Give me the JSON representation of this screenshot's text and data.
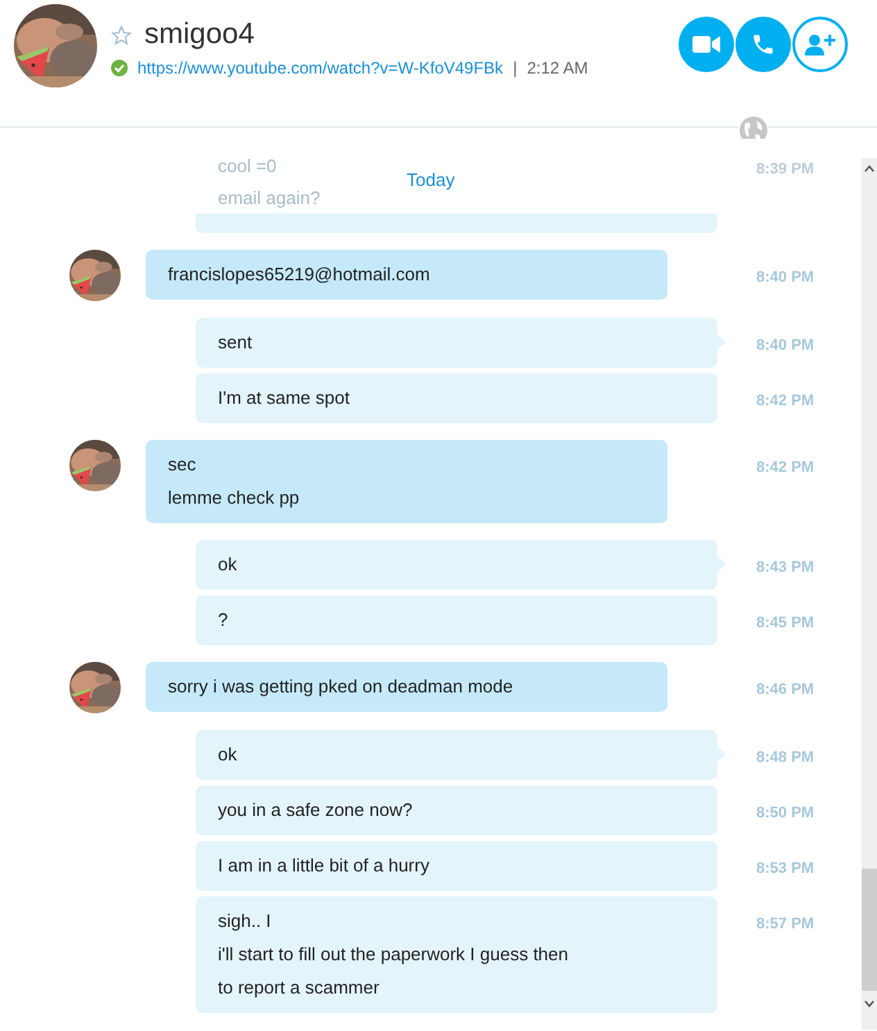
{
  "contact": {
    "name": "smigoo4",
    "favorite": false,
    "online": true,
    "mood_link": "https://www.youtube.com/watch?v=W-KfoV49FBk",
    "separator": "|",
    "local_time": "2:12 AM"
  },
  "date_label": "Today",
  "faded_message": {
    "lines": [
      "cool =0",
      "email again?"
    ],
    "time": "8:39 PM"
  },
  "messages": [
    {
      "kind": "incoming",
      "lines": [
        "francislopes65219@hotmail.com"
      ],
      "time": "8:40 PM"
    },
    {
      "kind": "outgoing",
      "lines": [
        "sent"
      ],
      "time": "8:40 PM"
    },
    {
      "kind": "outgoing",
      "lines": [
        "I'm at same spot"
      ],
      "time": "8:42 PM"
    },
    {
      "kind": "incoming",
      "lines": [
        "sec",
        "lemme check pp"
      ],
      "time": "8:42 PM"
    },
    {
      "kind": "outgoing",
      "lines": [
        "ok"
      ],
      "time": "8:43 PM"
    },
    {
      "kind": "outgoing",
      "lines": [
        "?"
      ],
      "time": "8:45 PM"
    },
    {
      "kind": "incoming",
      "lines": [
        "sorry i was getting pked on deadman mode"
      ],
      "time": "8:46 PM"
    },
    {
      "kind": "outgoing",
      "lines": [
        "ok"
      ],
      "time": "8:48 PM"
    },
    {
      "kind": "outgoing",
      "lines": [
        "you in a safe zone now?"
      ],
      "time": "8:50 PM"
    },
    {
      "kind": "outgoing",
      "lines": [
        "I am in a little bit of a hurry"
      ],
      "time": "8:53 PM"
    },
    {
      "kind": "outgoing",
      "lines": [
        "sigh.. I",
        "i'll start to fill out the paperwork I guess then",
        "to report a scammer"
      ],
      "time": "8:57 PM"
    }
  ]
}
